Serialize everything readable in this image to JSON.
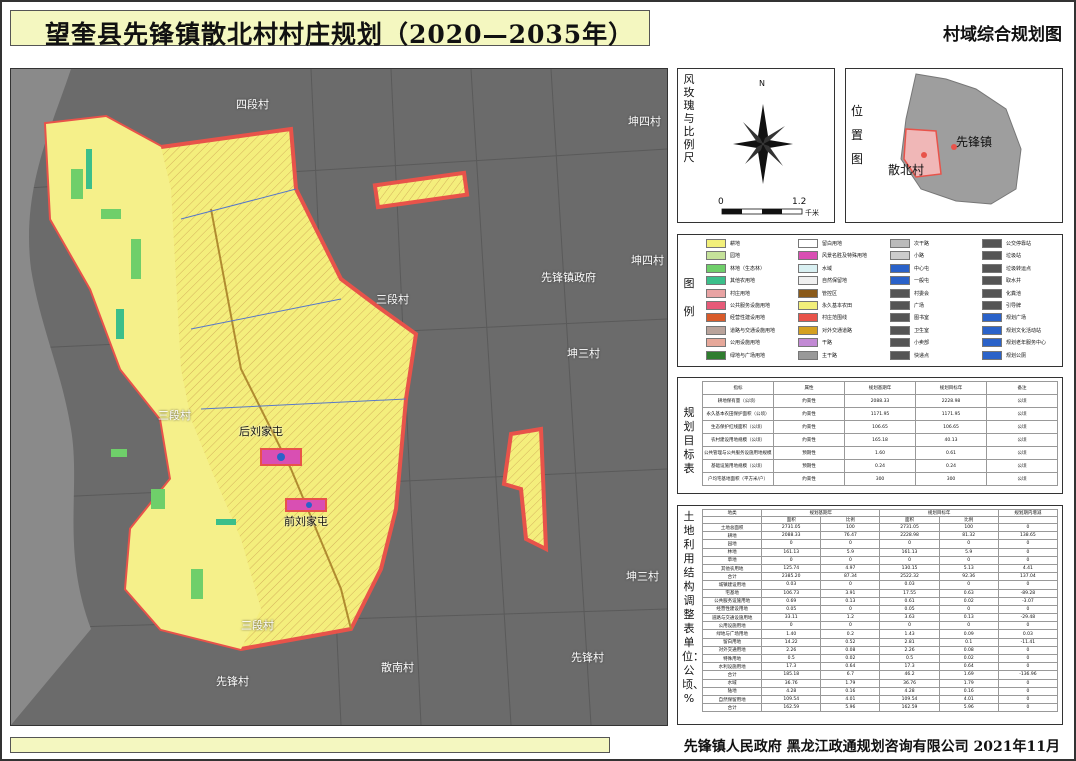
{
  "header": {
    "title": "望奎县先锋镇散北村村庄规划（2020—2035年）",
    "subtitle": "村域综合规划图"
  },
  "map": {
    "place_labels": {
      "siduan": "四段村",
      "kunsi": "坤四村",
      "kunliu": "坤四村",
      "sanduan_e": "三段村",
      "xianfeng_gov": "先锋镇政府",
      "kunsan_mid": "坤三村",
      "sanduan_w": "三段村",
      "houliu": "后刘家屯",
      "qianliu": "前刘家屯",
      "kunsan_se": "坤三村",
      "sanduan_s": "三段村",
      "sannan": "散南村",
      "xianfeng_village": "先锋村",
      "xianfeng_s": "先锋村"
    }
  },
  "compass": {
    "label": "风玫瑰与比例尺",
    "north": "N",
    "scale_start": "0",
    "scale_end": "1.2",
    "scale_unit": "千米"
  },
  "location_map": {
    "label": "位置图",
    "town": "先锋镇",
    "village": "散北村"
  },
  "legend": {
    "label": "图例",
    "items": [
      {
        "text": "耕地",
        "color": "#f2ef7a"
      },
      {
        "text": "园地",
        "color": "#c5e29a"
      },
      {
        "text": "林地（生态林）",
        "color": "#6fcf6a"
      },
      {
        "text": "其他农用地",
        "color": "#3bbf8a"
      },
      {
        "text": "村庄用地",
        "color": "#e8a3a3"
      },
      {
        "text": "公共服务设施用地",
        "color": "#e65a78"
      },
      {
        "text": "经营性建设用地",
        "color": "#d95b2a"
      },
      {
        "text": "道路与交通设施用地",
        "color": "#b9a39b"
      },
      {
        "text": "公用设施用地",
        "color": "#e6a89a"
      },
      {
        "text": "绿地与广场用地",
        "color": "#2f7d2f"
      },
      {
        "text": "留白用地",
        "color": "#ffffff"
      },
      {
        "text": "风景名胜及特殊用地",
        "color": "#d94fb3"
      },
      {
        "text": "水域",
        "color": "#d9f0f2"
      },
      {
        "text": "自然保留地",
        "color": "#f0f0f0"
      },
      {
        "text": "管控区",
        "color": "#8a5a1a"
      },
      {
        "text": "永久基本农田",
        "color": "#f2ef7a"
      },
      {
        "text": "村庄范围线",
        "color": "#e8534a"
      },
      {
        "text": "对外交通道路",
        "color": "#d4a020"
      },
      {
        "text": "干路",
        "color": "#c28ad4"
      },
      {
        "text": "主干路",
        "color": "#999999"
      },
      {
        "text": "次干路",
        "color": "#bbbbbb"
      },
      {
        "text": "小路",
        "color": "#cccccc"
      },
      {
        "text": "中心屯",
        "color": "#2a62c9"
      },
      {
        "text": "一般屯",
        "color": "#2a62c9"
      },
      {
        "text": "村委会",
        "color": "#555555"
      },
      {
        "text": "广场",
        "color": "#555555"
      },
      {
        "text": "图书室",
        "color": "#555555"
      },
      {
        "text": "卫生室",
        "color": "#555555"
      },
      {
        "text": "小卖部",
        "color": "#555555"
      },
      {
        "text": "快递点",
        "color": "#555555"
      },
      {
        "text": "公交停靠站",
        "color": "#555555"
      },
      {
        "text": "垃圾站",
        "color": "#555555"
      },
      {
        "text": "垃圾转运点",
        "color": "#555555"
      },
      {
        "text": "取水井",
        "color": "#555555"
      },
      {
        "text": "化粪池",
        "color": "#555555"
      },
      {
        "text": "引导牌",
        "color": "#555555"
      },
      {
        "text": "规划广场",
        "color": "#2a62c9"
      },
      {
        "text": "规划文化活动站",
        "color": "#2a62c9"
      },
      {
        "text": "规划老年服务中心",
        "color": "#2a62c9"
      },
      {
        "text": "规划公厕",
        "color": "#2a62c9"
      }
    ]
  },
  "targets": {
    "label": "规划目标表",
    "headers": [
      "指标",
      "属性",
      "规划基期年",
      "规划目标年",
      "备注"
    ],
    "rows": [
      [
        "耕地保有量（公顷）",
        "约束性",
        "2088.33",
        "2228.98",
        "公顷"
      ],
      [
        "永久基本农田保护面积（公顷）",
        "约束性",
        "1171.95",
        "1171.95",
        "公顷"
      ],
      [
        "生态保护红线面积（公顷）",
        "约束性",
        "106.65",
        "106.65",
        "公顷"
      ],
      [
        "农村建设用地规模（公顷）",
        "约束性",
        "165.18",
        "40.13",
        "公顷"
      ],
      [
        "公共管理与公共服务设施用地规模（公顷）",
        "预期性",
        "1.60",
        "0.61",
        "公顷"
      ],
      [
        "基础设施用地规模（公顷）",
        "预期性",
        "0.24",
        "0.24",
        "公顷"
      ],
      [
        "户均宅基地面积（平方米/户）",
        "约束性",
        "300",
        "300",
        "公顷"
      ]
    ]
  },
  "land_use": {
    "label": "土地利用结构调整表 单位：公顷、%",
    "headers": [
      "地类",
      "规划基期年",
      "规划目标年",
      "规划期内增减"
    ],
    "sub_headers": [
      "面积",
      "比例",
      "面积",
      "比例"
    ],
    "rows": [
      [
        "土地总面积",
        "2731.05",
        "100",
        "2731.05",
        "100",
        "0"
      ],
      [
        "耕地",
        "2088.33",
        "76.47",
        "2228.98",
        "81.32",
        "138.65"
      ],
      [
        "园地",
        "0",
        "0",
        "0",
        "0",
        "0"
      ],
      [
        "林地",
        "161.13",
        "5.9",
        "161.13",
        "5.9",
        "0"
      ],
      [
        "草地",
        "0",
        "0",
        "0",
        "0",
        "0"
      ],
      [
        "其他农用地",
        "125.74",
        "4.97",
        "130.15",
        "5.13",
        "4.41"
      ],
      [
        "合计",
        "2385.20",
        "87.34",
        "2522.32",
        "92.36",
        "137.04"
      ],
      [
        "城镇建设用地",
        "0.03",
        "0",
        "0.03",
        "0",
        "0"
      ],
      [
        "宅基地",
        "106.73",
        "3.91",
        "17.55",
        "0.63",
        "-89.28"
      ],
      [
        "公共服务设施用地",
        "0.69",
        "0.13",
        "0.61",
        "0.02",
        "-3.07"
      ],
      [
        "经营性建设用地",
        "0.05",
        "0",
        "0.05",
        "0",
        "0"
      ],
      [
        "道路与交通设施用地",
        "33.11",
        "1.2",
        "3.63",
        "0.13",
        "-29.48"
      ],
      [
        "公用设施用地",
        "0",
        "0",
        "0",
        "0",
        "0"
      ],
      [
        "绿地与广场用地",
        "1.40",
        "0.2",
        "1.43",
        "0.09",
        "0.03"
      ],
      [
        "留白用地",
        "14.22",
        "0.52",
        "2.81",
        "0.1",
        "-11.41"
      ],
      [
        "对外交通用地",
        "2.26",
        "0.08",
        "2.26",
        "0.08",
        "0"
      ],
      [
        "特殊用地",
        "0.5",
        "0.02",
        "0.5",
        "0.02",
        "0"
      ],
      [
        "水利设施用地",
        "17.3",
        "0.64",
        "17.3",
        "0.64",
        "0"
      ],
      [
        "合计",
        "185.18",
        "6.7",
        "46.2",
        "1.69",
        "-136.96"
      ],
      [
        "水域",
        "36.76",
        "1.79",
        "36.76",
        "1.79",
        "0"
      ],
      [
        "陆地",
        "4.28",
        "0.16",
        "4.28",
        "0.16",
        "0"
      ],
      [
        "自然保留用地",
        "109.54",
        "4.01",
        "109.54",
        "4.01",
        "0"
      ],
      [
        "合计",
        "162.59",
        "5.96",
        "162.59",
        "5.96",
        "0"
      ]
    ]
  },
  "footer": {
    "credit": "先锋镇人民政府  黑龙江政通规划咨询有限公司  2021年11月"
  }
}
